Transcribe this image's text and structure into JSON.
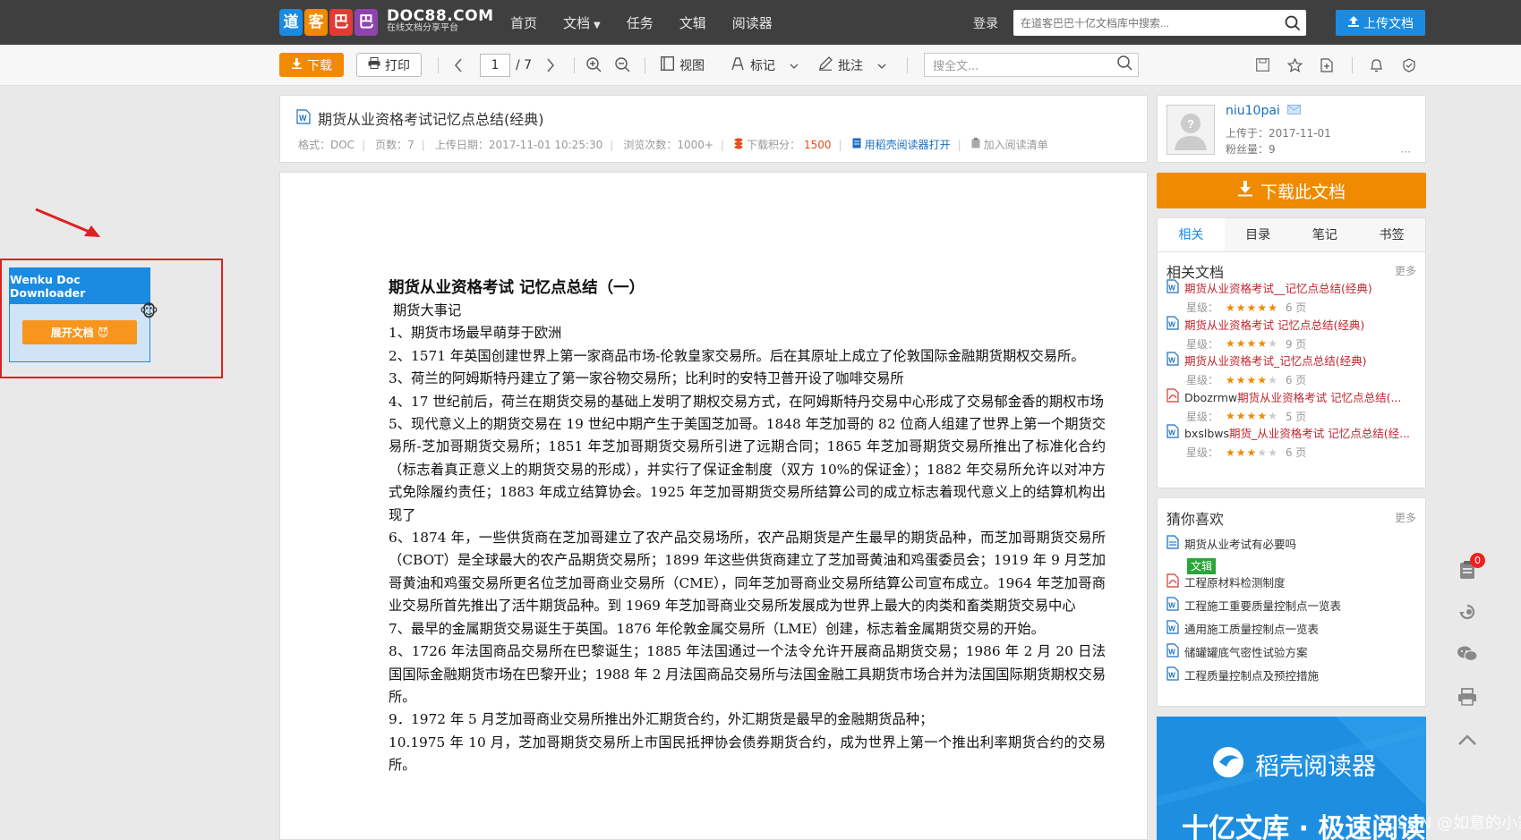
{
  "topbar": {
    "logo_chars": [
      "道",
      "客",
      "巴",
      "巴"
    ],
    "logo_colors": [
      "#1a8be0",
      "#f08a00",
      "#e53935",
      "#8e44ad"
    ],
    "logo_title": "DOC88.COM",
    "logo_subtitle": "在线文档分享平台",
    "nav": [
      "首页",
      "文档",
      "任务",
      "文辑",
      "阅读器"
    ],
    "login": "登录",
    "search_placeholder": "在道客巴巴十亿文档库中搜索...",
    "upload_label": "上传文档"
  },
  "toolbar": {
    "download_label": "下载",
    "print_label": "打印",
    "page_current": "1",
    "page_total": "/ 7",
    "view_label": "视图",
    "mark_label": "标记",
    "annotate_label": "批注",
    "search_placeholder": "搜全文..."
  },
  "doc_header": {
    "title": "期货从业资格考试记忆点总结(经典)",
    "format": "格式：DOC",
    "pages": "页数：7",
    "upload_date": "上传日期：2017-11-01 10:25:30",
    "views": "浏览次数：1000+",
    "points_label": "下载积分：",
    "points_value": "1500",
    "open_with": "用稻壳阅读器打开",
    "add_list": "加入阅读清单"
  },
  "doc_body": {
    "heading": "期货从业资格考试 记忆点总结（一）",
    "paragraphs": [
      " 期货大事记",
      "1、期货市场最早萌芽于欧洲",
      "2、1571 年英国创建世界上第一家商品市场-伦敦皇家交易所。后在其原址上成立了伦敦国际金融期货期权交易所。",
      "3、荷兰的阿姆斯特丹建立了第一家谷物交易所；比利时的安特卫普开设了咖啡交易所",
      "4、17 世纪前后，荷兰在期货交易的基础上发明了期权交易方式，在阿姆斯特丹交易中心形成了交易郁金香的期权市场",
      "5、现代意义上的期货交易在 19 世纪中期产生于美国芝加哥。1848 年芝加哥的 82 位商人组建了世界上第一个期货交易所-芝加哥期货交易所；1851 年芝加哥期货交易所引进了远期合同；1865 年芝加哥期货交易所推出了标准化合约（标志着真正意义上的期货交易的形成），并实行了保证金制度（双方 10%的保证金）；1882 年交易所允许以对冲方式免除履约责任；1883 年成立结算协会。1925 年芝加哥期货交易所结算公司的成立标志着现代意义上的结算机构出现了",
      "6、1874 年，一些供货商在芝加哥建立了农产品交易场所，农产品期货是产生最早的期货品种，而芝加哥期货交易所（CBOT）是全球最大的农产品期货交易所；1899 年这些供货商建立了芝加哥黄油和鸡蛋委员会；1919 年 9 月芝加哥黄油和鸡蛋交易所更名位芝加哥商业交易所（CME），同年芝加哥商业交易所结算公司宣布成立。1964 年芝加哥商业交易所首先推出了活牛期货品种。到 1969 年芝加哥商业交易所发展成为世界上最大的肉类和畜类期货交易中心",
      "7、最早的金属期货交易诞生于英国。1876 年伦敦金属交易所（LME）创建，标志着金属期货交易的开始。",
      "8、1726 年法国商品交易所在巴黎诞生；1885 年法国通过一个法令允许开展商品期货交易；1986 年 2 月 20 日法国国际金融期货市场在巴黎开业；1988 年 2 月法国商品交易所与法国金融工具期货市场合并为法国国际期货期权交易所。",
      "9．1972 年 5 月芝加哥商业交易所推出外汇期货合约，外汇期货是最早的金融期货品种；",
      "10.1975 年 10 月，芝加哥期货交易所上市国民抵押协会债券期货合约，成为世界上第一个推出利率期货合约的交易所。"
    ]
  },
  "user": {
    "name": "niu10pai",
    "uploaded": "上传于：2017-11-01",
    "fans": "粉丝量：9",
    "more": "···"
  },
  "download_doc_label": "下载此文档",
  "tabs": [
    "相关",
    "目录",
    "笔记",
    "书签"
  ],
  "related": {
    "title": "相关文档",
    "more": "更多",
    "rating_label": "星级：",
    "items": [
      {
        "prefix": "",
        "title": "期货从业资格考试__记忆点总结(经典)",
        "stars": 5,
        "pages": "6 页",
        "icon": "word"
      },
      {
        "prefix": "",
        "title": "期货从业资格考试 记忆点总结(经典)",
        "stars": 4,
        "pages": "9 页",
        "icon": "word"
      },
      {
        "prefix": "",
        "title": "期货从业资格考试_记忆点总结(经典)",
        "stars": 4,
        "pages": "6 页",
        "icon": "word"
      },
      {
        "prefix": "Dbozrmw",
        "title": "期货从业资格考试 记忆点总结(...",
        "stars": 4,
        "pages": "5 页",
        "icon": "pdf"
      },
      {
        "prefix": "bxslbws",
        "title": "期货_从业资格考试 记忆点总结(经...",
        "stars": 3,
        "pages": "6 页",
        "icon": "word"
      }
    ]
  },
  "guess": {
    "title": "猜你喜欢",
    "more": "更多",
    "tag": "文辑",
    "items": [
      {
        "title": "期货从业考试有必要吗",
        "icon": "doc"
      },
      {
        "title": "工程原材料检测制度",
        "icon": "pdf"
      },
      {
        "title": "工程施工重要质量控制点一览表",
        "icon": "word"
      },
      {
        "title": "通用施工质量控制点一览表",
        "icon": "word"
      },
      {
        "title": "储罐罐底气密性试验方案",
        "icon": "word"
      },
      {
        "title": "工程质量控制点及预控措施",
        "icon": "word"
      }
    ]
  },
  "banner": {
    "brand": "稻壳阅读器",
    "slogan": "十亿文库 · 极速阅读"
  },
  "side_badge": "0",
  "plugin": {
    "title": "Wenku Doc Downloader",
    "button": "展开文档 😈"
  },
  "watermark": "CSDN @如意的小家"
}
